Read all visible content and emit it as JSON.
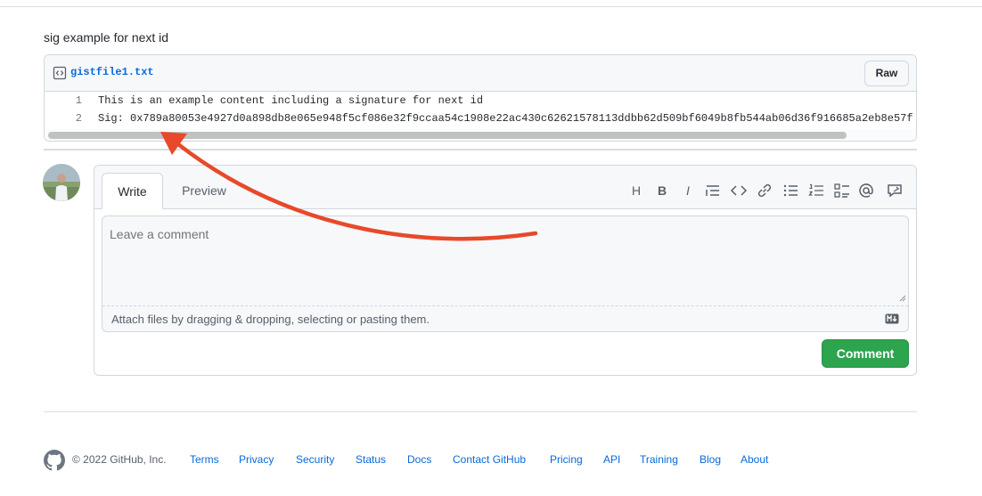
{
  "gist": {
    "description": "sig example for next id",
    "file_name": "gistfile1.txt",
    "raw_label": "Raw",
    "lines": [
      {
        "number": "1",
        "text": "This is an example content including a signature for next id"
      },
      {
        "number": "2",
        "text": "Sig: 0x789a80053e4927d0a898db8e065e948f5cf086e32f9ccaa54c1908e22ac430c62621578113ddbb62d509bf6049b8fb544ab06d36f916685a2eb8e57f"
      }
    ]
  },
  "comment": {
    "tabs": [
      {
        "label": "Write",
        "active": true
      },
      {
        "label": "Preview",
        "active": false
      }
    ],
    "toolbar_icons": [
      "heading-icon",
      "bold-icon",
      "italic-icon",
      "quote-icon",
      "code-icon",
      "link-icon",
      "unordered-list-icon",
      "ordered-list-icon",
      "task-list-icon",
      "mention-icon",
      "reference-icon"
    ],
    "placeholder": "Leave a comment",
    "attach_text": "Attach files by dragging & dropping, selecting or pasting them.",
    "submit_label": "Comment"
  },
  "footer": {
    "copyright": "© 2022 GitHub, Inc.",
    "links": [
      "Terms",
      "Privacy",
      "Security",
      "Status",
      "Docs",
      "Contact GitHub",
      "Pricing",
      "API",
      "Training",
      "Blog",
      "About"
    ]
  },
  "colors": {
    "link": "#0969da",
    "primary_button": "#2da44e",
    "annotation_arrow": "#e8492a"
  }
}
